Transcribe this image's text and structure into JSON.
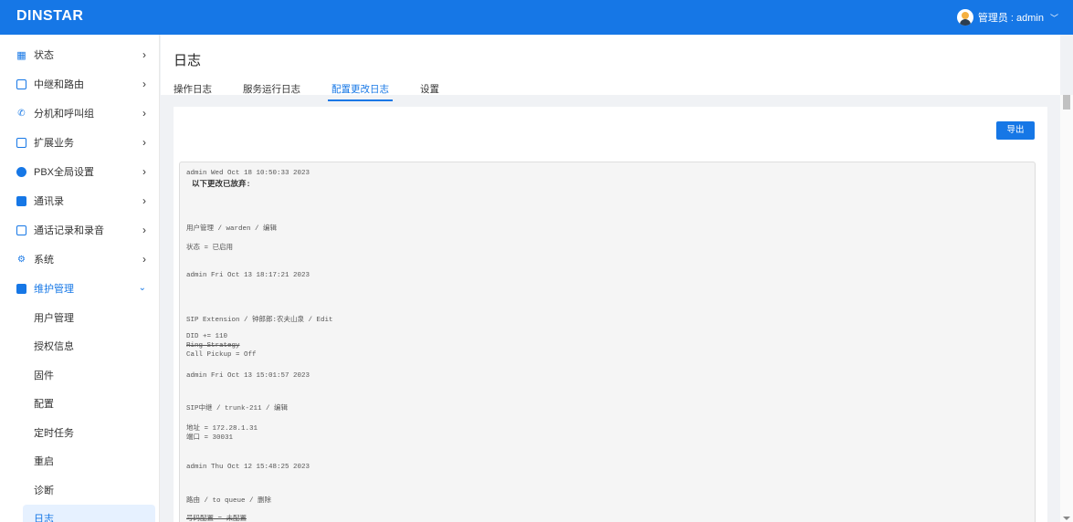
{
  "header": {
    "logo": "DINSTAR",
    "user": "管理员 : admin",
    "chevron": "﹀"
  },
  "sidebar": {
    "items": [
      {
        "label": "状态",
        "icon": "dashboard-icon"
      },
      {
        "label": "中继和路由",
        "icon": "trunk-icon"
      },
      {
        "label": "分机和呼叫组",
        "icon": "phone-icon"
      },
      {
        "label": "扩展业务",
        "icon": "extension-icon"
      },
      {
        "label": "PBX全局设置",
        "icon": "globe-icon"
      },
      {
        "label": "通讯录",
        "icon": "contacts-icon"
      },
      {
        "label": "通话记录和录音",
        "icon": "record-icon"
      },
      {
        "label": "系统",
        "icon": "gear-icon"
      },
      {
        "label": "维护管理",
        "icon": "maintenance-icon"
      }
    ],
    "sub_items": [
      "用户管理",
      "授权信息",
      "固件",
      "配置",
      "定时任务",
      "重启",
      "诊断",
      "日志"
    ]
  },
  "main": {
    "title": "日志",
    "tabs": [
      "操作日志",
      "服务运行日志",
      "配置更改日志",
      "设置"
    ],
    "active_tab": "配置更改日志",
    "export_label": "导出"
  },
  "log_lines": {
    "l1": "admin Wed Oct 18 10:50:33 2023",
    "l2": "以下更改已放弃:",
    "l3": "用户管理 / warden / 编辑",
    "l4": "状态 = 已启用",
    "l5": "admin Fri Oct 13 18:17:21 2023",
    "l6": "SIP Extension / 钟郎郎:农夫山泉 / Edit",
    "l7": "DID += 110",
    "l8": "Ring Strategy",
    "l9": "Call Pickup = Off",
    "l10": "admin Fri Oct 13 15:01:57 2023",
    "l11": "SIP中继 / trunk-211 / 编辑",
    "l12": "地址 = 172.28.1.31",
    "l13": "端口 = 30031",
    "l14": "admin Thu Oct 12 15:48:25 2023",
    "l15": "路由 / to queue / 删除",
    "l16": "号码配置 = 未配置"
  },
  "colors": {
    "accent": "#1677e6",
    "active_bg": "#e6f1ff"
  }
}
